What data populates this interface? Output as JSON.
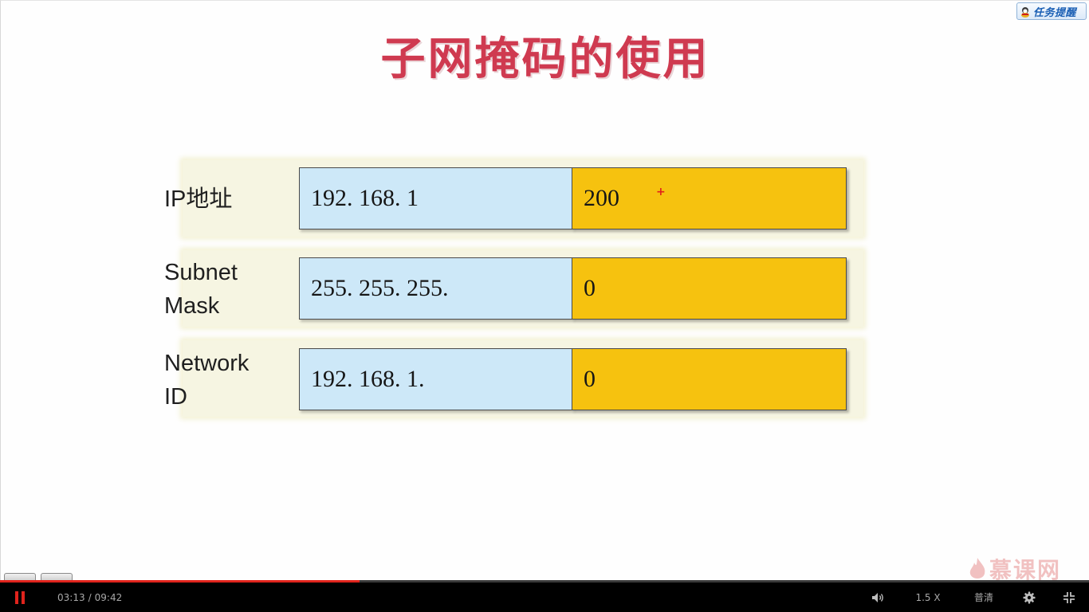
{
  "task_reminder": {
    "label": "任务提醒"
  },
  "slide": {
    "title": "子网掩码的使用",
    "rows": [
      {
        "label": "IP地址",
        "network": "192. 168. 1",
        "host": "200"
      },
      {
        "label": "Subnet\nMask",
        "network": "255. 255. 255.",
        "host": "0"
      },
      {
        "label": "Network\nID",
        "network": "192. 168. 1.",
        "host": "0"
      }
    ],
    "cursor_mark": "+"
  },
  "watermark": {
    "text": "慕课网"
  },
  "player": {
    "current_time": "03:13",
    "time_separator": "/",
    "total_time": "09:42",
    "progress_fraction": 0.33,
    "speed_label": "1.5 X",
    "quality_label": "普清",
    "icons": {
      "play_pause": "pause-icon",
      "volume": "volume-icon",
      "settings": "gear-icon",
      "fullscreen": "exit-fullscreen-icon"
    },
    "colors": {
      "accent": "#e0231c",
      "bar_bg": "#000000"
    }
  },
  "colors": {
    "title": "#cf3a50",
    "network_cell": "#cde8f8",
    "host_cell": "#f6c20f"
  }
}
